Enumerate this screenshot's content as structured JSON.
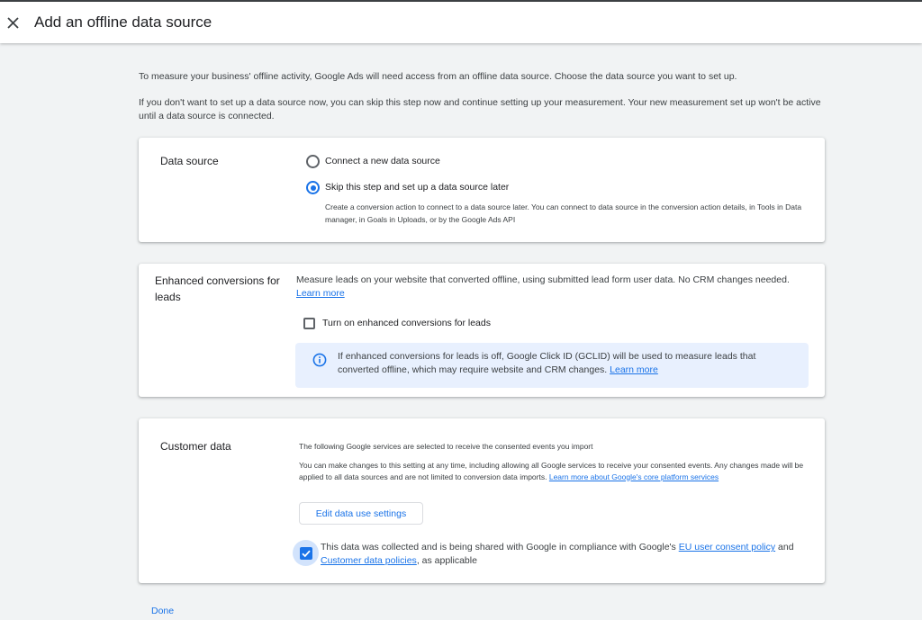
{
  "header": {
    "title": "Add an offline data source"
  },
  "intro": {
    "p1": "To measure your business' offline activity, Google Ads will need access from an offline data source. Choose the data source you want to set up.",
    "p2": "If you don't want to set up a data source now, you can skip this step now and continue setting up your measurement. Your new measurement set up won't be active until a data source is connected."
  },
  "data_source": {
    "title": "Data source",
    "option_new": "Connect a new data source",
    "option_skip": "Skip this step and set up a data source later",
    "selected": "option_skip",
    "skip_description": "Create a conversion action to connect to a data source later. You can connect to data source in the conversion action details, in Tools in Data manager, in Goals in Uploads, or by the Google Ads API"
  },
  "enhanced": {
    "title": "Enhanced conversions for leads",
    "description": "Measure leads on your website that converted offline, using submitted lead form user data. No CRM changes needed.",
    "learn_more": "Learn more",
    "checkbox_label": "Turn on enhanced conversions for leads",
    "checkbox_checked": false,
    "info_text": "If enhanced conversions for leads is off, Google Click ID (GCLID) will be used to measure leads that converted offline, which may require website and CRM changes.",
    "info_link": "Learn more"
  },
  "customer_data": {
    "title": "Customer data",
    "line1": "The following Google services are selected to receive the consented events you import",
    "line2": "You can make changes to this setting at any time, including allowing all Google services to receive your consented events. Any changes made will be applied to all data sources and are not limited to conversion data imports.",
    "line2_link": "Learn more about Google's core platform services",
    "edit_button": "Edit data use settings",
    "consent_prefix": "This data was collected and is being shared with Google in compliance with Google's",
    "consent_link1": "EU user consent policy",
    "consent_and": "and",
    "consent_link2": "Customer data policies",
    "consent_suffix": ", as applicable",
    "consent_checked": true
  },
  "footer": {
    "done": "Done"
  },
  "colors": {
    "accent": "#1a73e8",
    "info_bg": "#e8f0fe",
    "page_bg": "#f1f3f4"
  }
}
